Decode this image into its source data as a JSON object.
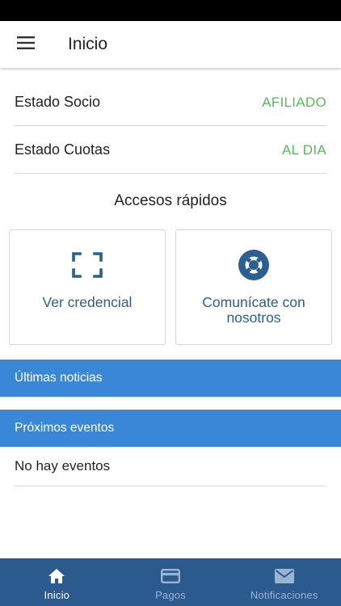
{
  "header": {
    "title": "Inicio",
    "menu_icon": "hamburger-menu-icon"
  },
  "status": {
    "socio": {
      "label": "Estado Socio",
      "value": "AFILIADO"
    },
    "cuotas": {
      "label": "Estado Cuotas",
      "value": "AL DIA"
    }
  },
  "quick_access": {
    "title": "Accesos rápidos",
    "cards": [
      {
        "label": "Ver credencial",
        "icon": "scan-frame-icon"
      },
      {
        "label": "Comunícate con nosotros",
        "icon": "lifebuoy-icon"
      }
    ]
  },
  "news": {
    "title": "Últimas noticias"
  },
  "events": {
    "title": "Próximos eventos",
    "empty_text": "No hay eventos"
  },
  "tabs": [
    {
      "label": "Inicio",
      "icon": "home-icon"
    },
    {
      "label": "Pagos",
      "icon": "credit-card-icon"
    },
    {
      "label": "Notificaciones",
      "icon": "envelope-icon"
    }
  ],
  "colors": {
    "primary_blue": "#3a87d8",
    "tab_bar": "#2a5a8e",
    "status_green": "#5cb85c",
    "accent_dark_blue": "#2a5f8f",
    "tab_active": "#ffffff",
    "tab_inactive": "#9ab4d2"
  }
}
